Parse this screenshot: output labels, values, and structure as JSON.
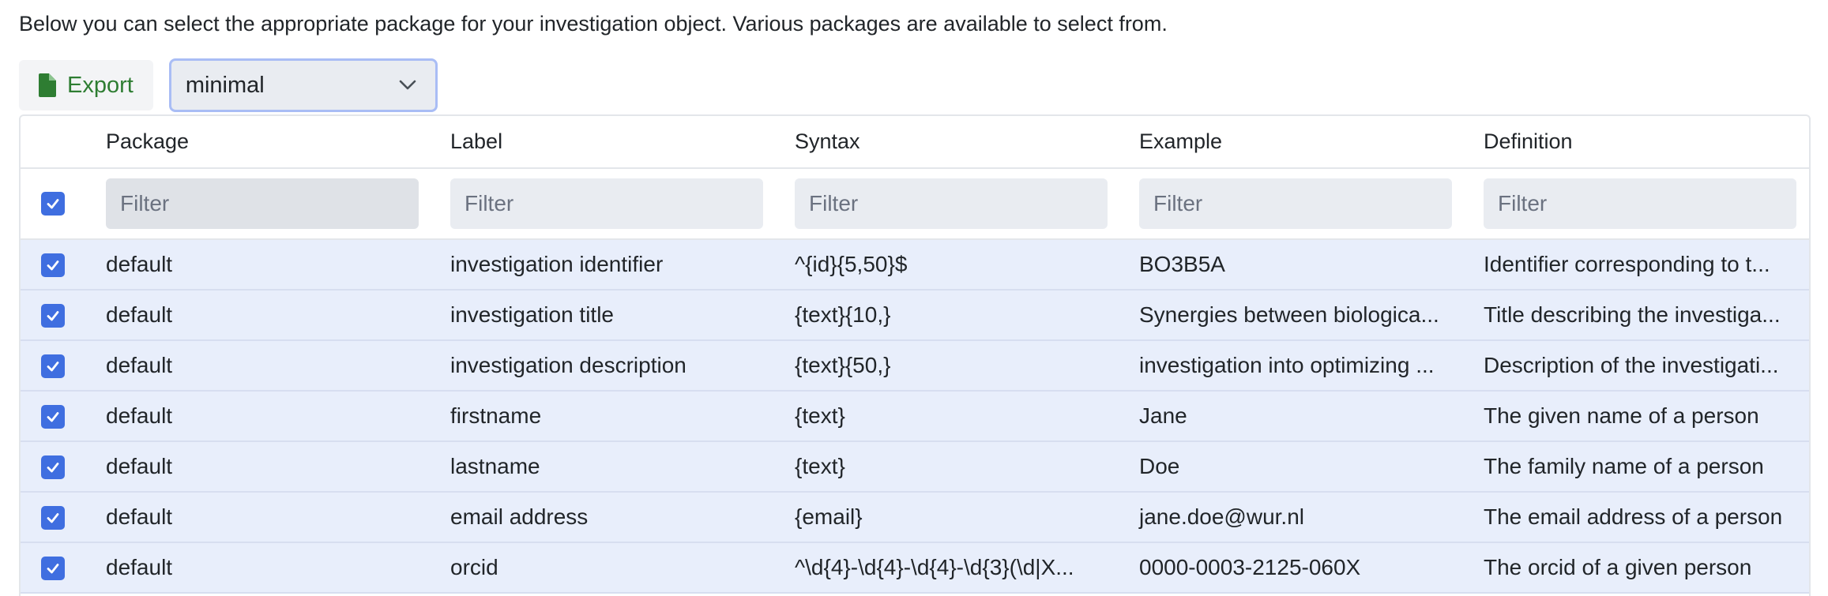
{
  "intro": "Below you can select the appropriate package for your investigation object. Various packages are available to select from.",
  "toolbar": {
    "export_label": "Export",
    "package_select": "minimal"
  },
  "table": {
    "headers": [
      "Package",
      "Label",
      "Syntax",
      "Example",
      "Definition"
    ],
    "filter_placeholder": "Filter",
    "rows": [
      {
        "package": "default",
        "label": "investigation identifier",
        "syntax": "^{id}{5,50}$",
        "example": "BO3B5A",
        "definition": "Identifier corresponding to t..."
      },
      {
        "package": "default",
        "label": "investigation title",
        "syntax": "{text}{10,}",
        "example": "Synergies between biologica...",
        "definition": "Title describing the investiga..."
      },
      {
        "package": "default",
        "label": "investigation description",
        "syntax": "{text}{50,}",
        "example": "investigation into optimizing ...",
        "definition": "Description of the investigati..."
      },
      {
        "package": "default",
        "label": "firstname",
        "syntax": "{text}",
        "example": "Jane",
        "definition": "The given name of a person"
      },
      {
        "package": "default",
        "label": "lastname",
        "syntax": "{text}",
        "example": "Doe",
        "definition": "The family name of a person"
      },
      {
        "package": "default",
        "label": "email address",
        "syntax": "{email}",
        "example": "jane.doe@wur.nl",
        "definition": "The email address of a person"
      },
      {
        "package": "default",
        "label": "orcid",
        "syntax": "^\\d{4}-\\d{4}-\\d{4}-\\d{3}(\\d|X...",
        "example": "0000-0003-2125-060X",
        "definition": "The orcid of a given person"
      }
    ]
  },
  "colors": {
    "accent": "#3f6ee0",
    "export_text": "#2e7d32",
    "row_bg": "#e8eefb"
  }
}
